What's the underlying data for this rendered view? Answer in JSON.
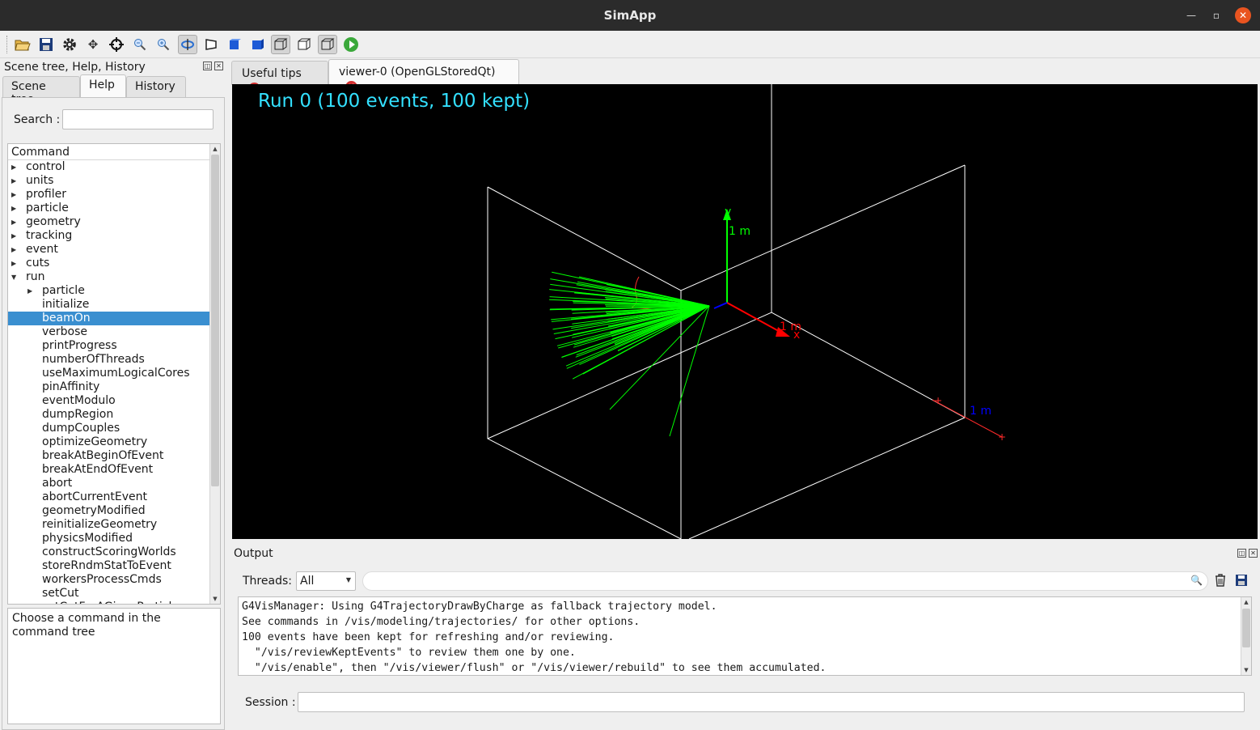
{
  "window": {
    "title": "SimApp",
    "minimize_icon": "minimize-icon",
    "maximize_icon": "restore-icon",
    "close_icon": "close-icon"
  },
  "toolbar": {
    "buttons": [
      {
        "name": "open-icon",
        "glyph": "📂"
      },
      {
        "name": "save-icon",
        "glyph": "💾"
      },
      {
        "name": "settings-icon",
        "glyph": "⚙"
      },
      {
        "name": "move-icon",
        "glyph": "✥"
      },
      {
        "name": "pick-icon",
        "glyph": "⌖"
      },
      {
        "name": "zoom-out-icon",
        "glyph": "🔍"
      },
      {
        "name": "zoom-in-icon",
        "glyph": "🔍"
      },
      {
        "name": "rotate-icon",
        "glyph": "↻"
      },
      {
        "name": "perspective-icon",
        "glyph": "◧"
      },
      {
        "name": "solid-icon",
        "glyph": "■"
      },
      {
        "name": "solid-alt-icon",
        "glyph": "■"
      },
      {
        "name": "wireframe-icon",
        "glyph": "⬚"
      },
      {
        "name": "hidden-line-icon",
        "glyph": "⬚"
      },
      {
        "name": "hidden-surface-icon",
        "glyph": "⬚"
      },
      {
        "name": "run-beamon-icon",
        "glyph": "▶"
      }
    ]
  },
  "left_dock": {
    "title": "Scene tree, Help, History",
    "tabs": [
      "Scene tree",
      "Help",
      "History"
    ],
    "active_tab": "Help",
    "search_label": "Search :",
    "search_value": "",
    "tree_header": "Command",
    "tree": [
      {
        "label": "control",
        "level": 0,
        "expandable": true,
        "expanded": false
      },
      {
        "label": "units",
        "level": 0,
        "expandable": true,
        "expanded": false
      },
      {
        "label": "profiler",
        "level": 0,
        "expandable": true,
        "expanded": false
      },
      {
        "label": "particle",
        "level": 0,
        "expandable": true,
        "expanded": false
      },
      {
        "label": "geometry",
        "level": 0,
        "expandable": true,
        "expanded": false
      },
      {
        "label": "tracking",
        "level": 0,
        "expandable": true,
        "expanded": false
      },
      {
        "label": "event",
        "level": 0,
        "expandable": true,
        "expanded": false
      },
      {
        "label": "cuts",
        "level": 0,
        "expandable": true,
        "expanded": false
      },
      {
        "label": "run",
        "level": 0,
        "expandable": true,
        "expanded": true
      },
      {
        "label": "particle",
        "level": 1,
        "expandable": true,
        "expanded": false
      },
      {
        "label": "initialize",
        "level": 1
      },
      {
        "label": "beamOn",
        "level": 1,
        "selected": true
      },
      {
        "label": "verbose",
        "level": 1
      },
      {
        "label": "printProgress",
        "level": 1
      },
      {
        "label": "numberOfThreads",
        "level": 1
      },
      {
        "label": "useMaximumLogicalCores",
        "level": 1
      },
      {
        "label": "pinAffinity",
        "level": 1
      },
      {
        "label": "eventModulo",
        "level": 1
      },
      {
        "label": "dumpRegion",
        "level": 1
      },
      {
        "label": "dumpCouples",
        "level": 1
      },
      {
        "label": "optimizeGeometry",
        "level": 1
      },
      {
        "label": "breakAtBeginOfEvent",
        "level": 1
      },
      {
        "label": "breakAtEndOfEvent",
        "level": 1
      },
      {
        "label": "abort",
        "level": 1
      },
      {
        "label": "abortCurrentEvent",
        "level": 1
      },
      {
        "label": "geometryModified",
        "level": 1
      },
      {
        "label": "reinitializeGeometry",
        "level": 1
      },
      {
        "label": "physicsModified",
        "level": 1
      },
      {
        "label": "constructScoringWorlds",
        "level": 1
      },
      {
        "label": "storeRndmStatToEvent",
        "level": 1
      },
      {
        "label": "workersProcessCmds",
        "level": 1
      },
      {
        "label": "setCut",
        "level": 1
      },
      {
        "label": "setCutForAGivenParticle",
        "level": 1
      }
    ],
    "help_text": "Choose a command in the command tree"
  },
  "viewer_tabs": [
    {
      "label": "Useful tips",
      "active": false
    },
    {
      "label": "viewer-0 (OpenGLStoredQt)",
      "active": true
    }
  ],
  "viewer": {
    "run_label": "Run 0 (100 events, 100 kept)",
    "axis_y_label": "y",
    "axis_y_unit": "1 m",
    "axis_x_label": "x",
    "axis_x_unit": "1 m",
    "scale_label": "1 m",
    "colors": {
      "run_label": "#33e0ff",
      "tracks": "#00ff00",
      "x_axis": "#ff0000",
      "y_axis": "#00ff00",
      "z_axis": "#0000ff",
      "geometry": "#ffffff",
      "scale": "#0000ff"
    }
  },
  "output_dock": {
    "title": "Output",
    "threads_label": "Threads:",
    "threads_value": "All",
    "filter_value": "",
    "lines": [
      "G4VisManager: Using G4TrajectoryDrawByCharge as fallback trajectory model.",
      "See commands in /vis/modeling/trajectories/ for other options.",
      "100 events have been kept for refreshing and/or reviewing.",
      "  \"/vis/reviewKeptEvents\" to review them one by one.",
      "  \"/vis/enable\", then \"/vis/viewer/flush\" or \"/vis/viewer/rebuild\" to see them accumulated."
    ],
    "session_label": "Session :",
    "session_value": ""
  }
}
